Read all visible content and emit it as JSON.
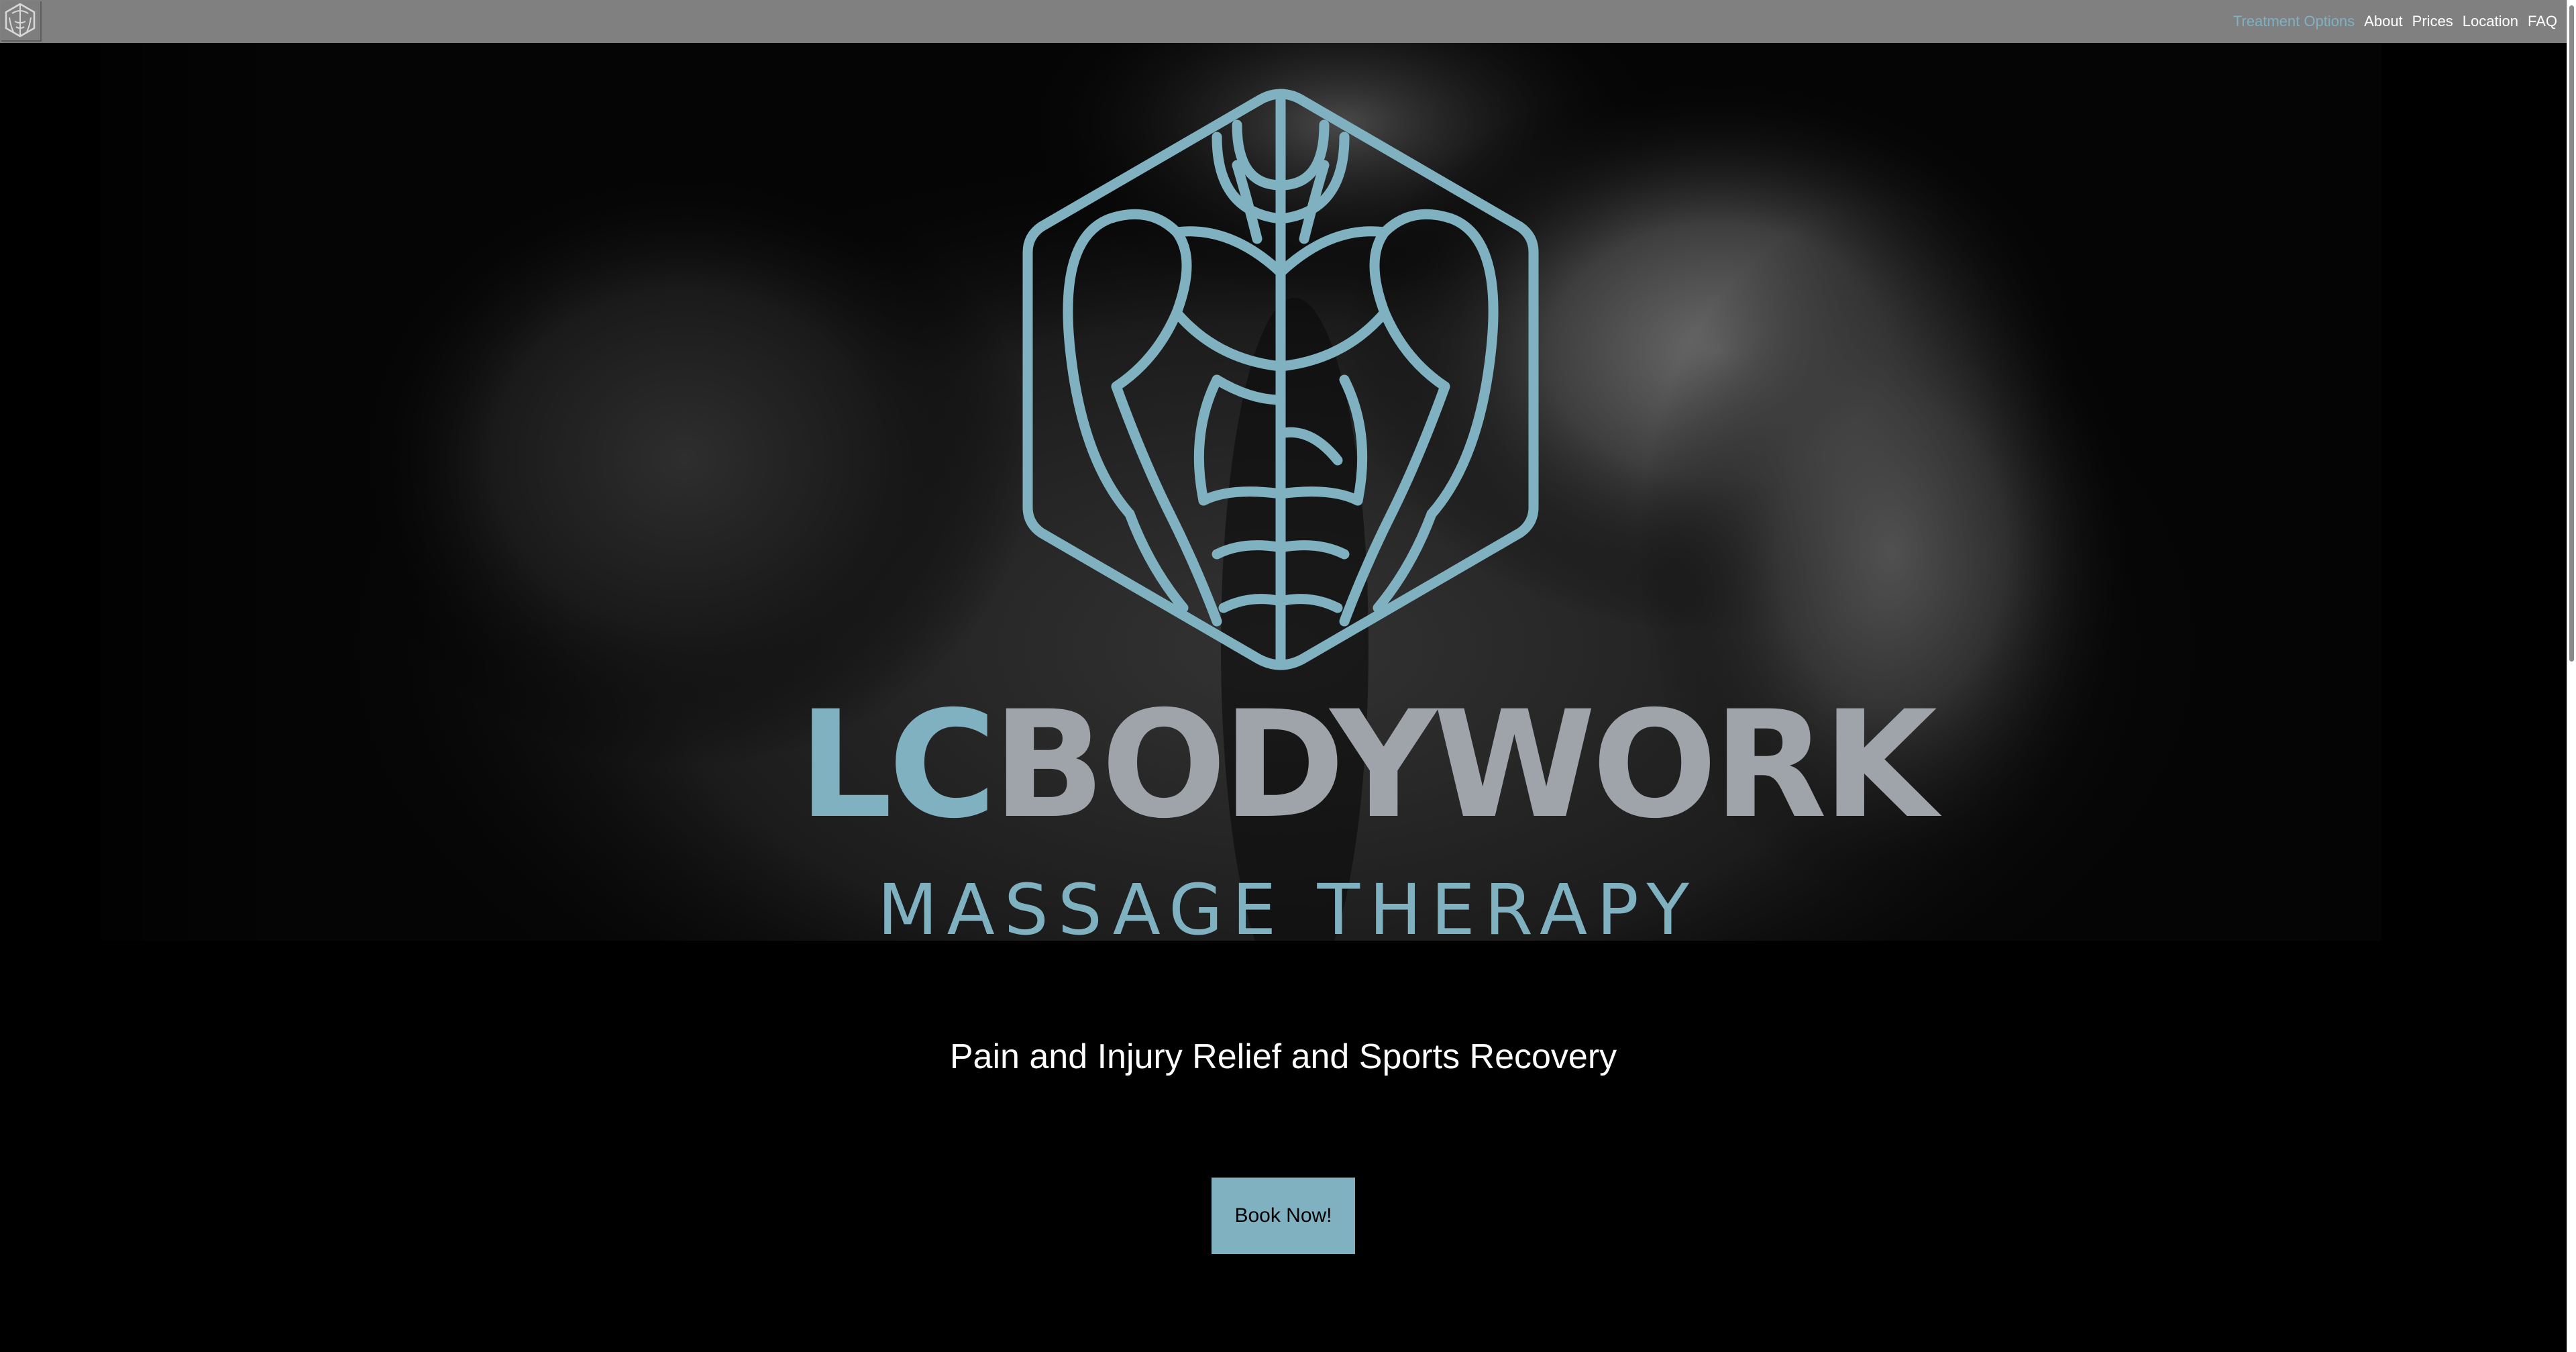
{
  "nav": {
    "logo_icon": "hexagon-torso-logo",
    "links": [
      {
        "label": "Treatment Options",
        "active": true
      },
      {
        "label": "About",
        "active": false
      },
      {
        "label": "Prices",
        "active": false
      },
      {
        "label": "Location",
        "active": false
      },
      {
        "label": "FAQ",
        "active": false
      }
    ]
  },
  "hero": {
    "background_image": "black-and-white back and shoulders photo",
    "logo_icon": "hexagon-torso-muscle-logo",
    "brand_lc": "LC",
    "brand_rest": "BODYWORK",
    "tagline": "MASSAGE THERAPY"
  },
  "main": {
    "subtitle": "Pain and Injury Relief and Sports Recovery",
    "book_button_label": "Book Now!"
  },
  "colors": {
    "accent": "#7fb1c0",
    "nav_bg": "#808080",
    "wordmark_grey": "#9fa4aa",
    "page_bg": "#000000",
    "nav_text": "#ffffff"
  }
}
